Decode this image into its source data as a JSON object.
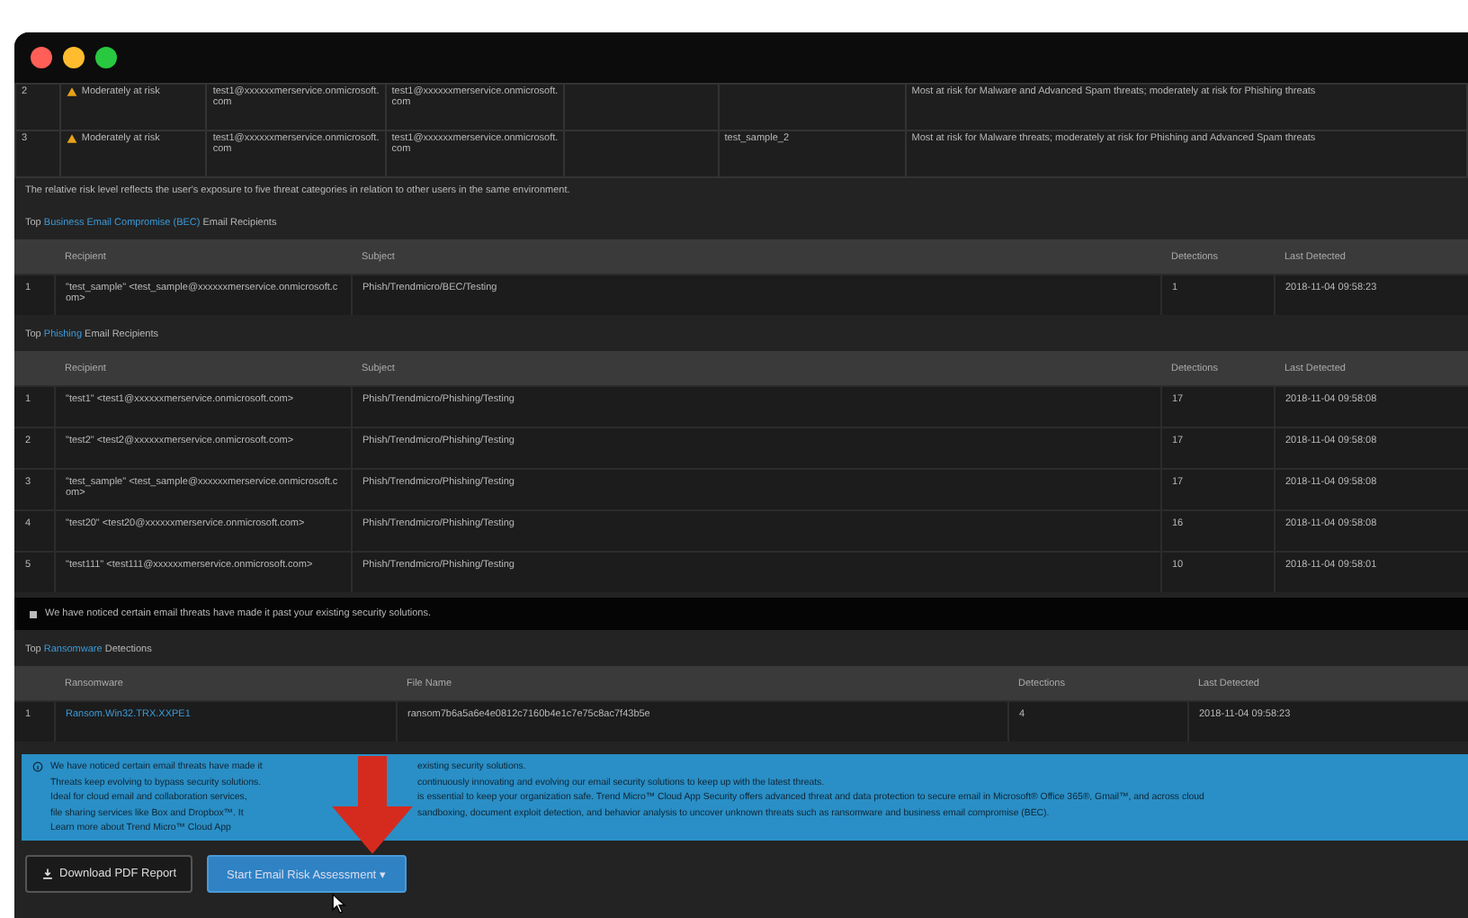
{
  "risk_rows": [
    {
      "cells": [
        "2",
        "Moderately at risk",
        "test1@xxxxxxmerservice.onmicrosoft.com",
        "test1@xxxxxxmerservice.onmicrosoft.com",
        "",
        "",
        "Most at risk for Malware and Advanced Spam threats; moderately at risk for Phishing threats"
      ]
    },
    {
      "cells": [
        "3",
        "Moderately at risk",
        "test1@xxxxxxmerservice.onmicrosoft.com",
        "test1@xxxxxxmerservice.onmicrosoft.com",
        "",
        "test_sample_2",
        "Most at risk for Malware threats; moderately at risk for Phishing and Advanced Spam threats"
      ]
    }
  ],
  "risk_note": "The relative risk level reflects the user's exposure to five threat categories in relation to other users in the same environment.",
  "sections": [
    {
      "heading": {
        "prefix": "Top",
        "link": "Business Email Compromise (BEC)",
        "suffix": "Email Recipients"
      },
      "columns": [
        "",
        "Recipient",
        "Subject",
        "Detections",
        "Last Detected"
      ],
      "rows": [
        {
          "cells": [
            {
              "text": "1"
            },
            {
              "text": "\"test_sample\" <test_sample@xxxxxxmerservice.onmicrosoft.com>"
            },
            {
              "text": "Phish/Trendmicro/BEC/Testing"
            },
            {
              "text": "1"
            },
            {
              "text": "2018-11-04 09:58:23"
            }
          ]
        }
      ]
    },
    {
      "heading": {
        "prefix": "Top",
        "link": "Phishing",
        "suffix": "Email Recipients"
      },
      "columns": [
        "",
        "Recipient",
        "Subject",
        "Detections",
        "Last Detected"
      ],
      "rows": [
        {
          "cells": [
            {
              "text": "1"
            },
            {
              "text": "\"test1\" <test1@xxxxxxmerservice.onmicrosoft.com>"
            },
            {
              "text": "Phish/Trendmicro/Phishing/Testing"
            },
            {
              "text": "17"
            },
            {
              "text": "2018-11-04 09:58:08"
            }
          ]
        },
        {
          "cells": [
            {
              "text": "2"
            },
            {
              "text": "\"test2\" <test2@xxxxxxmerservice.onmicrosoft.com>"
            },
            {
              "text": "Phish/Trendmicro/Phishing/Testing"
            },
            {
              "text": "17"
            },
            {
              "text": "2018-11-04 09:58:08"
            }
          ]
        },
        {
          "cells": [
            {
              "text": "3"
            },
            {
              "text": "\"test_sample\" <test_sample@xxxxxxmerservice.onmicrosoft.com>"
            },
            {
              "text": "Phish/Trendmicro/Phishing/Testing"
            },
            {
              "text": "17"
            },
            {
              "text": "2018-11-04 09:58:08"
            }
          ]
        },
        {
          "cells": [
            {
              "text": "4"
            },
            {
              "text": "\"test20\" <test20@xxxxxxmerservice.onmicrosoft.com>"
            },
            {
              "text": "Phish/Trendmicro/Phishing/Testing"
            },
            {
              "text": "16"
            },
            {
              "text": "2018-11-04 09:58:08"
            }
          ]
        },
        {
          "cells": [
            {
              "text": "5"
            },
            {
              "text": "\"test111\" <test111@xxxxxxmerservice.onmicrosoft.com>"
            },
            {
              "text": "Phish/Trendmicro/Phishing/Testing"
            },
            {
              "text": "10"
            },
            {
              "text": "2018-11-04 09:58:01"
            }
          ]
        }
      ]
    }
  ],
  "banner": "We have noticed certain email threats have made it past your existing security solutions.",
  "ransomware": {
    "heading": {
      "prefix": "Top",
      "link": "Ransomware",
      "suffix": "Detections"
    },
    "columns": [
      "",
      "Ransomware",
      "File Name",
      "Detections",
      "Last Detected"
    ],
    "rows": [
      {
        "cells": [
          {
            "text": "1"
          },
          {
            "text": "Ransom.Win32.TRX.XXPE1",
            "link": true
          },
          {
            "text": "ransom7b6a5a6e4e0812c7160b4e1c7e75c8ac7f43b5e"
          },
          {
            "text": "4"
          },
          {
            "text": "2018-11-04 09:58:23"
          }
        ]
      }
    ]
  },
  "info": [
    {
      "left": "We have noticed certain email threats have made it",
      "right": "existing security solutions."
    },
    {
      "left": "Threats keep evolving to bypass security solutions.",
      "right": "continuously innovating and evolving our email security solutions to keep up with the latest threats."
    },
    {
      "left": "Ideal for cloud email and collaboration services,",
      "right": "is essential to keep your organization safe. Trend Micro™ Cloud App Security offers advanced threat and data protection to secure email in Microsoft® Office 365®, Gmail™, and across cloud"
    },
    {
      "left": "file sharing services like Box and Dropbox™. It",
      "right": "sandboxing, document exploit detection, and behavior analysis to uncover unknown threats such as ransomware and business email compromise (BEC)."
    },
    {
      "left": "Learn more about Trend Micro™ Cloud App"
    }
  ],
  "buttons": [
    {
      "kind": "secondary",
      "label": "Download PDF Report"
    },
    {
      "kind": "primary",
      "label": "Start Email Risk Assessment",
      "caret": "▾"
    }
  ]
}
